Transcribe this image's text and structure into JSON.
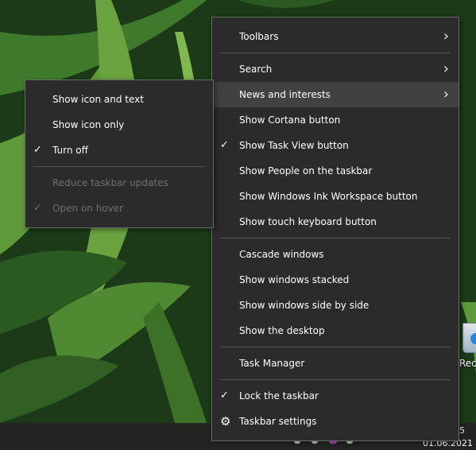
{
  "taskbar": {
    "time": "5",
    "date": "01.06.2021"
  },
  "desktop": {
    "recycle_bin_label": "Recycle"
  },
  "context_menu": {
    "toolbars": "Toolbars",
    "search": "Search",
    "news_and_interests": "News and interests",
    "show_cortana": "Show Cortana button",
    "show_task_view": "Show Task View button",
    "show_people": "Show People on the taskbar",
    "show_ink_workspace": "Show Windows Ink Workspace button",
    "show_touch_keyboard": "Show touch keyboard button",
    "cascade": "Cascade windows",
    "stacked": "Show windows stacked",
    "side_by_side": "Show windows side by side",
    "show_desktop": "Show the desktop",
    "task_manager": "Task Manager",
    "lock_taskbar": "Lock the taskbar",
    "taskbar_settings": "Taskbar settings"
  },
  "news_submenu": {
    "show_icon_and_text": "Show icon and text",
    "show_icon_only": "Show icon only",
    "turn_off": "Turn off",
    "reduce_updates": "Reduce taskbar updates",
    "open_on_hover": "Open on hover"
  },
  "icons": {
    "check": "✓",
    "chevron": "›",
    "gear": "⚙"
  }
}
